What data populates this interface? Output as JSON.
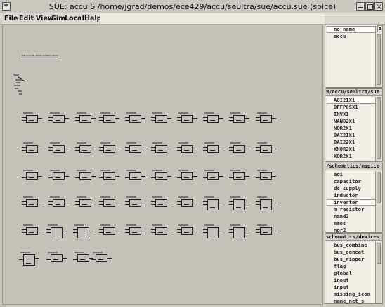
{
  "window": {
    "title": "SUE:  accu S /home/jgrad/demos/ece429/accu/seultra/sue/accu.sue  (spice)"
  },
  "menu": [
    "File",
    "Edit",
    "View",
    "Sim",
    "Local",
    "Help"
  ],
  "canvas": {
    "schematic_title": "SIM accu 4B 4M S4 fA/demo demo B4"
  },
  "panels": {
    "top": {
      "items": [
        "no_name",
        "accu"
      ],
      "button": "a"
    },
    "library1": {
      "title": "9/accu/seultra/sue",
      "items": [
        "AOI21X1",
        "DFFPOSX1",
        "INVX1",
        "NAND2X1",
        "NOR2X1",
        "OAI21X1",
        "OAI22X1",
        "XNOR2X1",
        "XOR2X1"
      ]
    },
    "library2": {
      "title": "/schematics/mspice",
      "items": [
        "aoi",
        "capacitor",
        "dc_supply",
        "inductor",
        "inverter",
        "m_resistor",
        "nand2",
        "nmos",
        "nor2"
      ]
    },
    "library3": {
      "title": "schematics/devices",
      "items": [
        "bus_combine",
        "bus_concat",
        "bus_ripper",
        "flag",
        "global",
        "inout",
        "input",
        "missing_icon",
        "name_net_s"
      ]
    }
  },
  "colors": {
    "background": "#c9c7bf",
    "canvas": "#c3c1b9",
    "list_bg": "#f0eee6"
  }
}
